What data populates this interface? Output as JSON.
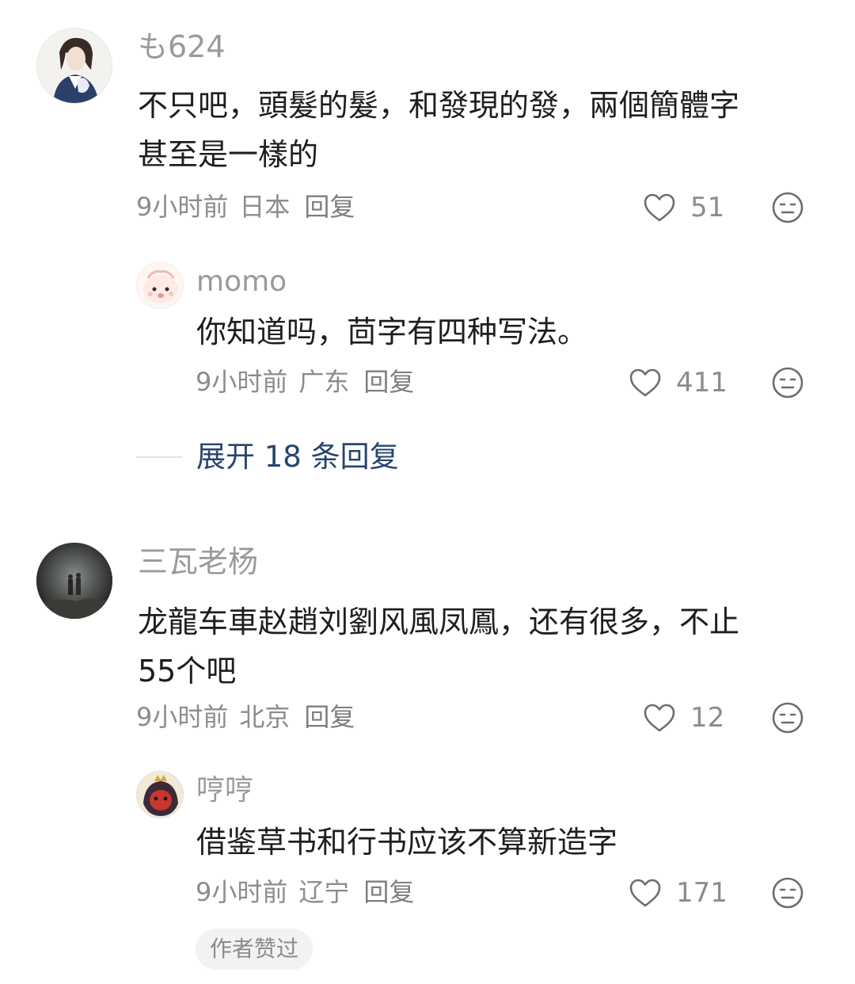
{
  "comments": [
    {
      "username": "も624",
      "text": "不只吧，頭髮的髮，和發現的發，兩個簡體字\n甚至是一樣的",
      "time": "9小时前",
      "location": "日本",
      "reply_label": "回复",
      "likes": "51",
      "replies": [
        {
          "username": "momo",
          "text": "你知道吗，茴字有四种写法。",
          "time": "9小时前",
          "location": "广东",
          "reply_label": "回复",
          "likes": "411"
        }
      ],
      "expand_label": "展开 18 条回复"
    },
    {
      "username": "三瓦老杨",
      "text": "龙龍车車赵趙刘劉风風凤鳳，还有很多，不止\n55个吧",
      "time": "9小时前",
      "location": "北京",
      "reply_label": "回复",
      "likes": "12",
      "replies": [
        {
          "username": "哼哼",
          "text": "借鉴草书和行书应该不算新造字",
          "time": "9小时前",
          "location": "辽宁",
          "reply_label": "回复",
          "likes": "171",
          "badge": "作者赞过"
        }
      ]
    }
  ],
  "icons": {
    "like": "heart-outline-icon",
    "dislike": "neutral-face-icon"
  },
  "colors": {
    "username": "#9a9a9a",
    "text": "#1e1e1e",
    "meta": "#8c8c8c",
    "expand_link": "#27456e",
    "badge_bg": "#f2f2f2"
  }
}
